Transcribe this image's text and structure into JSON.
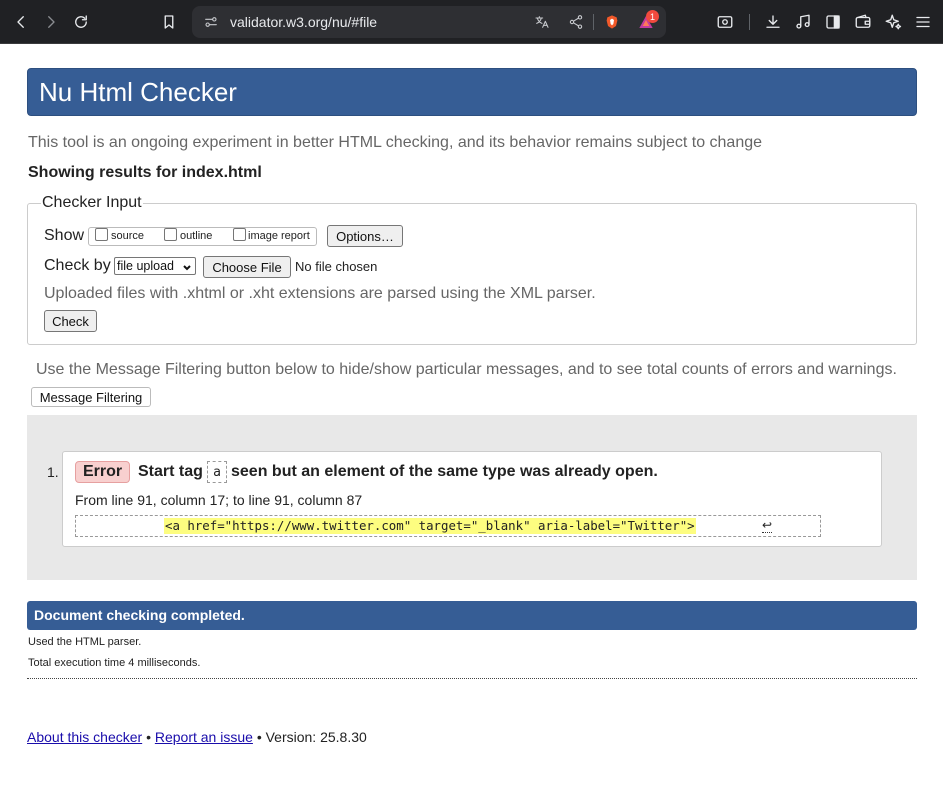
{
  "browser": {
    "url": "validator.w3.org/nu/#file",
    "badge_count": "1",
    "icons": [
      "back-icon",
      "forward-icon",
      "reload-icon",
      "bookmark-icon",
      "site-info-icon",
      "translate-icon",
      "share-icon",
      "brave-shields-icon",
      "brave-rewards-icon",
      "screenshot-icon",
      "download-icon",
      "media-icon",
      "sidebar-icon",
      "wallet-icon",
      "leo-ai-icon",
      "menu-icon"
    ]
  },
  "page": {
    "title": "Nu Html Checker",
    "intro": "This tool is an ongoing experiment in better HTML checking, and its behavior remains subject to change",
    "showing_results": "Showing results for index.html",
    "checker_input": {
      "legend": "Checker Input",
      "show_label": "Show",
      "options": [
        {
          "label": "source",
          "checked": false
        },
        {
          "label": "outline",
          "checked": false
        },
        {
          "label": "image report",
          "checked": false
        }
      ],
      "options_button": "Options…",
      "check_by_label": "Check by",
      "check_by_value": "file upload",
      "choose_file_button": "Choose File",
      "file_status": "No file chosen",
      "xml_note": "Uploaded files with .xhtml or .xht extensions are parsed using the XML parser.",
      "check_button": "Check"
    },
    "filter_note": "Use the Message Filtering button below to hide/show particular messages, and to see total counts of errors and warnings.",
    "filter_button": "Message Filtering",
    "messages": [
      {
        "number": "1.",
        "type": "Error",
        "text_before": "Start tag",
        "code": "a",
        "text_after": "seen but an element of the same type was already open.",
        "location": "From line 91, column 17; to line 91, column 87",
        "extract": "<a href=\"https://www.twitter.com\" target=\"_blank\" aria-label=\"Twitter\">",
        "extract_tail": "↩"
      }
    ],
    "completed": "Document checking completed.",
    "parser_note": "Used the HTML parser.",
    "exec_time": "Total execution time 4 milliseconds.",
    "footer": {
      "about": "About this checker",
      "sep1": "•",
      "report": "Report an issue",
      "version": "• Version: 25.8.30"
    }
  },
  "colors": {
    "header_blue": "#365d95",
    "error_badge": "#f8d0cf",
    "highlight": "#fdfd80",
    "results_bg": "#e8e8e8"
  }
}
